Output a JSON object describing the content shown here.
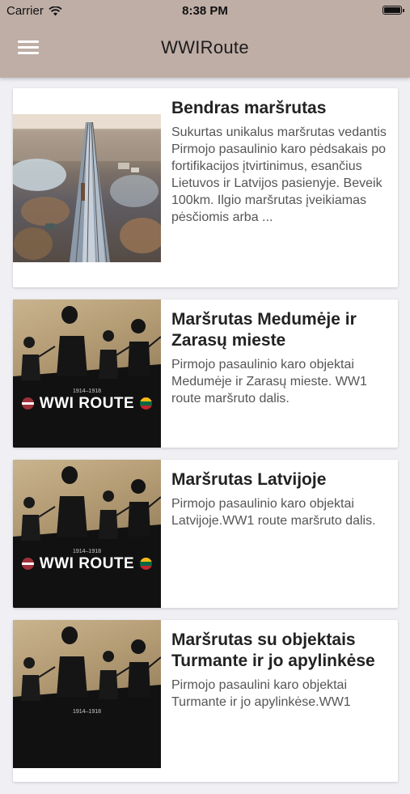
{
  "status": {
    "carrier": "Carrier",
    "time": "8:38 PM"
  },
  "header": {
    "title": "WWIRoute"
  },
  "poster": {
    "years": "1914–1918",
    "logo": "WWI ROUTE"
  },
  "routes": [
    {
      "title": "Bendras maršrutas",
      "description": "Sukurtas unikalus maršrutas vedantis Pirmojo pasaulinio karo pėdsakais po fortifikacijos įtvirtinimus, esančius Lietuvos ir Latvijos pasienyje. Beveik 100km. Ilgio maršrutas įveikiamas pėsčiomis arba ..."
    },
    {
      "title": "Maršrutas Medumėje ir Zarasų mieste",
      "description": "Pirmojo pasaulinio karo objektai Medumėje ir Zarasų mieste. WW1 route maršruto dalis."
    },
    {
      "title": "Maršrutas Latvijoje",
      "description": "Pirmojo pasaulinio karo objektai Latvijoje.WW1 route maršruto dalis."
    },
    {
      "title": "Maršrutas su objektais Turmante ir jo apylinkėse",
      "description": "Pirmojo pasaulini karo objektai Turmante ir jo apylinkėse.WW1"
    }
  ]
}
